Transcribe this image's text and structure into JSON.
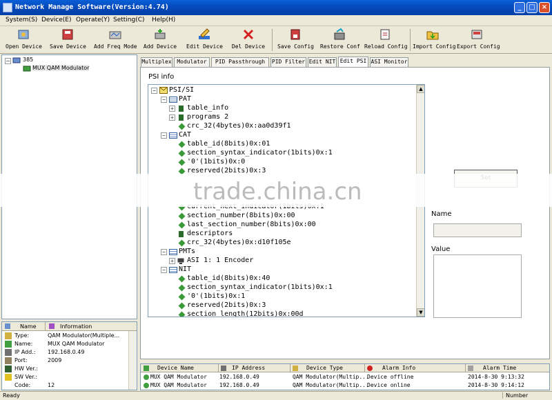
{
  "window": {
    "title": "Network Manage Software(Version:4.74)"
  },
  "menu": [
    "System(S)",
    "Device(E)",
    "Operate(Y)",
    "Setting(C)",
    "Help(H)"
  ],
  "toolbar": [
    {
      "label": "Open Device",
      "icon": "open-device-icon"
    },
    {
      "label": "Save Device",
      "icon": "save-device-icon"
    },
    {
      "label": "Add Freq Mode",
      "icon": "add-freq-mode-icon"
    },
    {
      "label": "Add Device",
      "icon": "add-device-icon"
    },
    {
      "label": "Edit Device",
      "icon": "edit-device-icon"
    },
    {
      "label": "Del Device",
      "icon": "delete-icon"
    },
    {
      "label": "Save Config",
      "icon": "save-config-icon"
    },
    {
      "label": "Restore Conf",
      "icon": "restore-config-icon"
    },
    {
      "label": "Reload Config",
      "icon": "reload-config-icon"
    },
    {
      "label": "Import Config",
      "icon": "import-config-icon"
    },
    {
      "label": "Export Config",
      "icon": "export-config-icon"
    }
  ],
  "device_tree": {
    "root": "385",
    "child": "MUX QAM Modulator"
  },
  "info": {
    "headers": [
      "Name",
      "Information"
    ],
    "rows": [
      {
        "k": "Type:",
        "v": "QAM Modulator(Multiple..."
      },
      {
        "k": "Name:",
        "v": "MUX QAM Modulator"
      },
      {
        "k": "IP Add.:",
        "v": "192.168.0.49"
      },
      {
        "k": "Port:",
        "v": "2009"
      },
      {
        "k": "HW Ver.:",
        "v": ""
      },
      {
        "k": "SW Ver.:",
        "v": ""
      },
      {
        "k": "Code:",
        "v": "12"
      }
    ]
  },
  "tabs": [
    "Multiplex",
    "Modulator",
    "PID Passthrough",
    "PID Filter",
    "Edit NIT",
    "Edit PSI",
    "ASI Monitor"
  ],
  "active_tab": "Edit PSI",
  "psi": {
    "label": "PSI info",
    "nodes": [
      {
        "t": "PSI/SI"
      },
      {
        "t": "PAT"
      },
      {
        "t": "table_info"
      },
      {
        "t": "programs 2"
      },
      {
        "t": "crc_32(4bytes)0x:aa0d39f1"
      },
      {
        "t": "CAT"
      },
      {
        "t": "table_id(8bits)0x:01"
      },
      {
        "t": "section_syntax_indicator(1bits)0x:1"
      },
      {
        "t": "'0'(1bits)0x:0"
      },
      {
        "t": "reserved(2bits)0x:3"
      },
      {
        "t": "current_next_indicator(1bits)0x:1"
      },
      {
        "t": "section_number(8bits)0x:00"
      },
      {
        "t": "last_section_number(8bits)0x:00"
      },
      {
        "t": "descriptors"
      },
      {
        "t": "crc_32(4bytes)0x:d10f105e"
      },
      {
        "t": "PMTs"
      },
      {
        "t": "ASI 1: 1 Encoder"
      },
      {
        "t": "NIT"
      },
      {
        "t": "table_id(8bits)0x:40"
      },
      {
        "t": "section_syntax_indicator(1bits)0x:1"
      },
      {
        "t": "'0'(1bits)0x:1"
      },
      {
        "t": "reserved(2bits)0x:3"
      },
      {
        "t": "section_length(12bits)0x:00d"
      }
    ],
    "side_button": "Set",
    "name_label": "Name",
    "value_label": "Value"
  },
  "alarms": {
    "headers": [
      "Device Name",
      "IP Address",
      "Device Type",
      "Alarm Info",
      "Alarm Time"
    ],
    "rows": [
      [
        "MUX QAM Modulator",
        "192.168.0.49",
        "QAM Modulator(Multip...",
        "Device offline",
        "2014-8-30 9:13:32"
      ],
      [
        "MUX QAM Modulator",
        "192.168.0.49",
        "QAM Modulator(Multip...",
        "Device online",
        "2014-8-30 9:14:12"
      ]
    ]
  },
  "status": {
    "left": "Ready",
    "right": "Number"
  },
  "watermark": "trade.china.cn"
}
